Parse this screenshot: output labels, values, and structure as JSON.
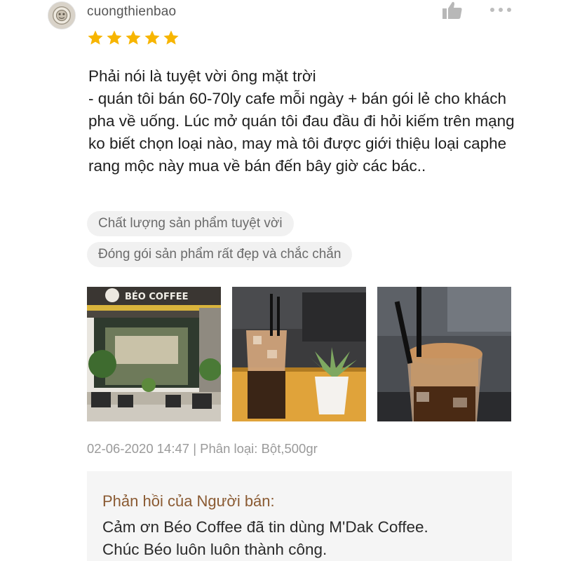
{
  "review": {
    "username": "cuongthienbao",
    "rating": 5,
    "text": "Phải nói là tuyệt vời ông mặt trời\n- quán tôi bán 60-70ly cafe mỗi ngày + bán gói lẻ cho khách pha về uống. Lúc mở quán tôi đau đầu đi hỏi kiếm trên mạng ko biết chọn loại nào, may mà tôi được giới thiệu loại caphe rang mộc này mua về bán đến bây giờ các bác..",
    "tags": [
      "Chất lượng sản phẩm tuyệt vời",
      "Đóng gói sản phẩm rất đẹp và chắc chắn"
    ],
    "photos": [
      {
        "icon": "storefront-photo",
        "sign_text": "BÉO COFFEE"
      },
      {
        "icon": "iced-coffee-photo"
      },
      {
        "icon": "iced-coffee-foam-photo"
      }
    ],
    "meta": "02-06-2020 14:47 | Phân loại: Bột,500gr"
  },
  "seller_reply": {
    "title": "Phản hồi của Người bán:",
    "text": "Cảm ơn Béo Coffee đã tin dùng M'Dak Coffee.\nChúc Béo luôn luôn thành công."
  },
  "colors": {
    "star": "#f7b500",
    "reply_title": "#8a5a32",
    "tag_bg": "#f1f1f1"
  }
}
